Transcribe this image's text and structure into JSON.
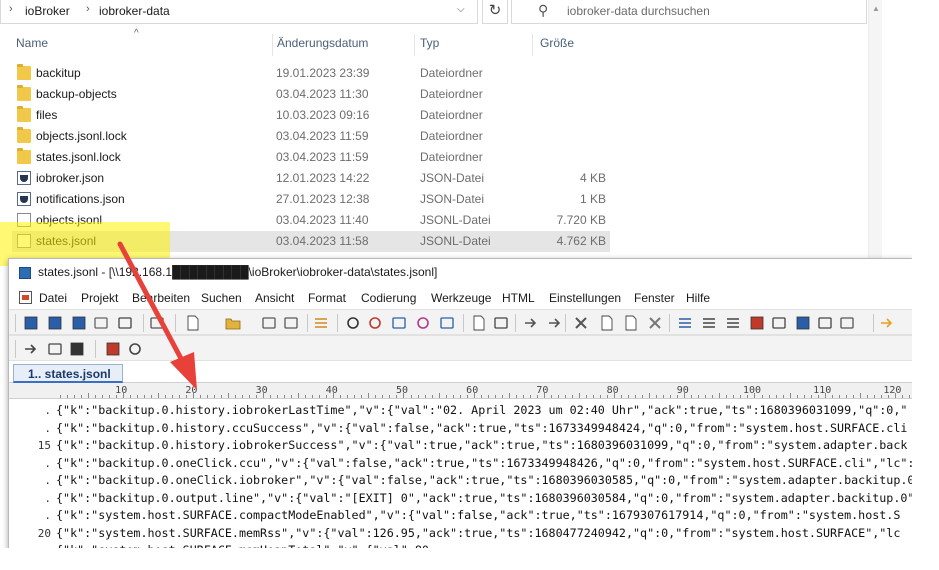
{
  "explorer": {
    "breadcrumb": [
      "ioBroker",
      "iobroker-data"
    ],
    "search_placeholder": "iobroker-data durchsuchen",
    "columns": {
      "name": "Name",
      "date": "Änderungsdatum",
      "type": "Typ",
      "size": "Größe"
    },
    "files": [
      {
        "name": "backitup",
        "date": "19.01.2023 23:39",
        "type": "Dateiordner",
        "size": "",
        "icon": "folder-icon"
      },
      {
        "name": "backup-objects",
        "date": "03.04.2023 11:30",
        "type": "Dateiordner",
        "size": "",
        "icon": "folder-icon"
      },
      {
        "name": "files",
        "date": "10.03.2023 09:16",
        "type": "Dateiordner",
        "size": "",
        "icon": "folder-icon"
      },
      {
        "name": "objects.jsonl.lock",
        "date": "03.04.2023 11:59",
        "type": "Dateiordner",
        "size": "",
        "icon": "folder-icon"
      },
      {
        "name": "states.jsonl.lock",
        "date": "03.04.2023 11:59",
        "type": "Dateiordner",
        "size": "",
        "icon": "folder-icon"
      },
      {
        "name": "iobroker.json",
        "date": "12.01.2023 14:22",
        "type": "JSON-Datei",
        "size": "4 KB",
        "icon": "json-file-icon"
      },
      {
        "name": "notifications.json",
        "date": "27.01.2023 12:38",
        "type": "JSON-Datei",
        "size": "1 KB",
        "icon": "json-file-icon"
      },
      {
        "name": "objects.jsonl",
        "date": "03.04.2023 11:40",
        "type": "JSONL-Datei",
        "size": "7.720 KB",
        "icon": "document-icon"
      },
      {
        "name": "states.jsonl",
        "date": "03.04.2023 11:58",
        "type": "JSONL-Datei",
        "size": "4.762 KB",
        "icon": "document-icon",
        "selected": true
      }
    ]
  },
  "editor": {
    "title": "states.jsonl - [\\\\192.168.1█████████\\ioBroker\\iobroker-data\\states.jsonl]",
    "menu": [
      "Datei",
      "Projekt",
      "Bearbeiten",
      "Suchen",
      "Ansicht",
      "Format",
      "Codierung",
      "Werkzeuge",
      "HTML",
      "Einstellungen",
      "Fenster",
      "Hilfe"
    ],
    "tab": "1.. states.jsonl",
    "ruler": [
      "10",
      "20",
      "30",
      "40",
      "50",
      "60",
      "70",
      "80",
      "90",
      "100",
      "110",
      "120"
    ],
    "lines": [
      {
        "num": ".",
        "text": "{\"k\":\"backitup.0.history.iobrokerLastTime\",\"v\":{\"val\":\"02. April 2023 um 02:40 Uhr\",\"ack\":true,\"ts\":1680396031099,\"q\":0,\""
      },
      {
        "num": ".",
        "text": "{\"k\":\"backitup.0.history.ccuSuccess\",\"v\":{\"val\":false,\"ack\":true,\"ts\":1673349948424,\"q\":0,\"from\":\"system.host.SURFACE.cli"
      },
      {
        "num": "15",
        "text": "{\"k\":\"backitup.0.history.iobrokerSuccess\",\"v\":{\"val\":true,\"ack\":true,\"ts\":1680396031099,\"q\":0,\"from\":\"system.adapter.back"
      },
      {
        "num": ".",
        "text": "{\"k\":\"backitup.0.oneClick.ccu\",\"v\":{\"val\":false,\"ack\":true,\"ts\":1673349948426,\"q\":0,\"from\":\"system.host.SURFACE.cli\",\"lc\":"
      },
      {
        "num": ".",
        "text": "{\"k\":\"backitup.0.oneClick.iobroker\",\"v\":{\"val\":false,\"ack\":true,\"ts\":1680396030585,\"q\":0,\"from\":\"system.adapter.backitup.0"
      },
      {
        "num": ".",
        "text": "{\"k\":\"backitup.0.output.line\",\"v\":{\"val\":\"[EXIT] 0\",\"ack\":true,\"ts\":1680396030584,\"q\":0,\"from\":\"system.adapter.backitup.0\""
      },
      {
        "num": ".",
        "text": "{\"k\":\"system.host.SURFACE.compactModeEnabled\",\"v\":{\"val\":false,\"ack\":true,\"ts\":1679307617914,\"q\":0,\"from\":\"system.host.S"
      },
      {
        "num": "20",
        "text": "{\"k\":\"system.host.SURFACE.memRss\",\"v\":{\"val\":126.95,\"ack\":true,\"ts\":1680477240942,\"q\":0,\"from\":\"system.host.SURFACE\",\"lc"
      },
      {
        "num": ".",
        "text": "{\"k\":\"system.host.SURFACE.memHeapTotal\",\"v\":{\"val\":80,"
      }
    ]
  },
  "colors": {
    "highlight": "#fff200",
    "arrow": "#e8413a",
    "accent": "#3a6fc2"
  }
}
